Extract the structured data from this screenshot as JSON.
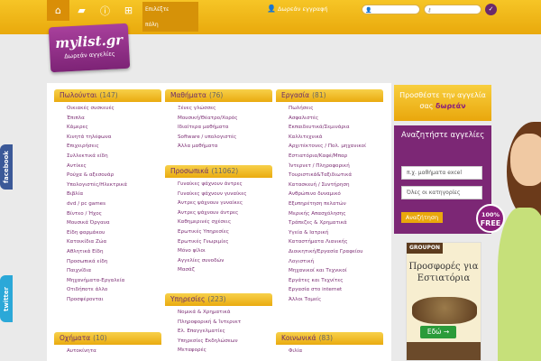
{
  "topbar": {
    "city_button": "Επιλέξτε\nπόλη",
    "register": "Δωρεάν εγγραφή",
    "email_placeholder": "",
    "password_placeholder": "",
    "go": "✓"
  },
  "logo": {
    "title": "mylist.gr",
    "tagline": "Δωρεάν αγγελίες"
  },
  "social": {
    "facebook": "facebook",
    "twitter": "twitter"
  },
  "sections": {
    "sale": {
      "title": "Πωλούνται",
      "count": "(147)",
      "items": [
        "Οικιακές συσκευές",
        "Έπιπλα",
        "Κάμερες",
        "Κινητά τηλέφωνα",
        "Επιχειρήσεις",
        "Συλλεκτικά είδη",
        "Αντίκες",
        "Ρούχα & αξεσουάρ",
        "Υπολογιστές/Ηλεκτρικά",
        "Βιβλία",
        "dvd / pc games",
        "Βίντεο / Ήχος",
        "Μουσικά Όργανα",
        "Είδη φαρμάκου",
        "Κατοικίδια Ζώα",
        "Αθλητικά Είδη",
        "Προσωπικά είδη",
        "Παιχνίδια",
        "Μηχανήματα-Εργαλεία",
        "Οτιδήποτε άλλο",
        "Προσφέρονται"
      ]
    },
    "vehicles": {
      "title": "Οχήματα",
      "count": "(10)",
      "items": [
        "Αυτοκίνητα"
      ]
    },
    "lessons": {
      "title": "Μαθήματα",
      "count": "(76)",
      "items": [
        "Ξένες γλώσσες",
        "Μουσική/Θέατρο/Χορός",
        "Ιδιαίτερα μαθήματα",
        "Software / υπολογιστές",
        "Άλλα μαθήματα"
      ]
    },
    "personal": {
      "title": "Προσωπικά",
      "count": "(11062)",
      "items": [
        "Γυναίκες ψάχνουν άντρες",
        "Γυναίκες ψάχνουν γυναίκες",
        "Άντρες ψάχνουν γυναίκες",
        "Άντρες ψάχνουν άντρες",
        "Καθημερινές σχέσεις",
        "Ερωτικές Υπηρεσίες",
        "Ερωτικές Γνωριμίες",
        "Μόνο φίλοι",
        "Αγγελίες συνοδών",
        "Μασάζ"
      ]
    },
    "services": {
      "title": "Υπηρεσίες",
      "count": "(223)",
      "items": [
        "Νομικά & Χρηματικά",
        "Πληροφορική & Ίντερνετ",
        "Ελ. Επαγγελματίες",
        "Υπηρεσίες Εκδηλώσεων",
        "Μεταφορές"
      ]
    },
    "jobs": {
      "title": "Εργασία",
      "count": "(81)",
      "items": [
        "Πωλήσεις",
        "Ασφαλιστές",
        "Εκπαιδευτικά/Σεμινάρια",
        "Καλλιτεχνικά",
        "Αρχιτέκτονες / Πολ. μηχανικοί",
        "Εστιατόρια/Καφέ/Μπαρ",
        "Ίντερνετ / Πληροφορική",
        "Τουριστικά&Ταξιδιωτικά",
        "Κατασκευή / Συντήρηση",
        "Ανθρώπινο δυναμικό",
        "Εξυπηρέτηση πελατών",
        "Μερικής Απασχόλησης",
        "Τράπεζες & Χρηματικά",
        "Υγεία & Ιατρική",
        "Καταστήματα Λιανικής",
        "Διοικητική/Εργασία Γραφείου",
        "Λογιστική",
        "Μηχανικοί και Τεχνικοί",
        "Εργάτες και Τεχνίτες",
        "Εργασία στο internet",
        "Άλλοι Τομείς"
      ]
    },
    "social": {
      "title": "Κοινωνικά",
      "count": "(83)",
      "items": [
        "Φιλία"
      ]
    }
  },
  "promo": {
    "line1": "Προσθέστε την αγγελία",
    "line2": "σας",
    "highlight": "δωρεάν"
  },
  "search": {
    "heading": "Αναζητήστε αγγελίες",
    "query_value": "π.χ. μαθήματα excel",
    "category_value": "Όλες οι κατηγορίες",
    "button": "Αναζήτηση"
  },
  "badge": {
    "percent": "100%",
    "text": "FREE"
  },
  "ad": {
    "brand": "GROUPON",
    "headline": "Προσφορές για Εστιατόρια",
    "button": "Εδώ →"
  }
}
